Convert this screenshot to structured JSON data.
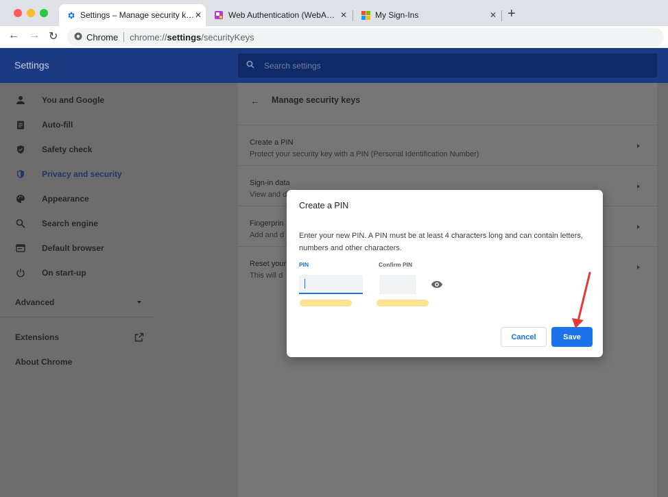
{
  "browser": {
    "tabs": [
      {
        "title": "Settings – Manage security keys",
        "favicon": "gear-icon",
        "active": true
      },
      {
        "title": "Web Authentication (WebAuthn)",
        "favicon": "webauthn-icon",
        "active": false
      },
      {
        "title": "My Sign-Ins",
        "favicon": "microsoft-icon",
        "active": false
      }
    ],
    "omnibox": {
      "chip": "Chrome",
      "url_scheme": "chrome://",
      "url_host": "settings",
      "url_path": "/securityKeys"
    }
  },
  "settings": {
    "header_title": "Settings",
    "search_placeholder": "Search settings",
    "sidebar": {
      "items": [
        {
          "label": "You and Google",
          "icon": "person-icon"
        },
        {
          "label": "Auto-fill",
          "icon": "clipboard-icon"
        },
        {
          "label": "Safety check",
          "icon": "shield-check-icon"
        },
        {
          "label": "Privacy and security",
          "icon": "shield-icon",
          "selected": true
        },
        {
          "label": "Appearance",
          "icon": "palette-icon"
        },
        {
          "label": "Search engine",
          "icon": "search-icon"
        },
        {
          "label": "Default browser",
          "icon": "browser-icon"
        },
        {
          "label": "On start-up",
          "icon": "power-icon"
        }
      ],
      "advanced": "Advanced",
      "extensions": "Extensions",
      "about": "About Chrome"
    },
    "page_title": "Manage security keys",
    "rows": [
      {
        "title": "Create a PIN",
        "subtitle": "Protect your security key with a PIN (Personal Identification Number)"
      },
      {
        "title": "Sign-in data",
        "subtitle": "View and d"
      },
      {
        "title": "Fingerprin",
        "subtitle": "Add and d"
      },
      {
        "title": "Reset your",
        "subtitle": "This will d"
      }
    ]
  },
  "dialog": {
    "title": "Create a PIN",
    "body": "Enter your new PIN. A PIN must be at least 4 characters long and can contain letters, numbers and other characters.",
    "pin_label": "PIN",
    "confirm_label": "Confirm PIN",
    "pin_value": "",
    "confirm_value": "",
    "cancel": "Cancel",
    "save": "Save"
  },
  "colors": {
    "accent": "#1a73e8",
    "header": "#1a3a82",
    "annotation_arrow": "#e53935",
    "hint": "#fde293"
  }
}
